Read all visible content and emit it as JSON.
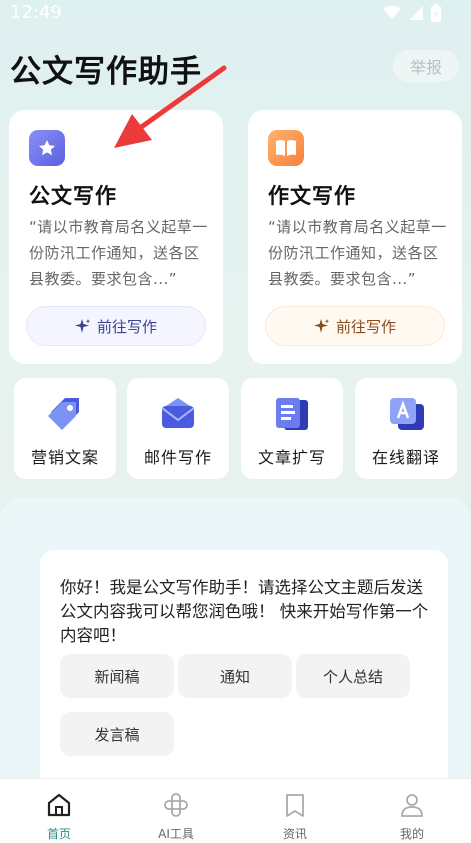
{
  "status_bar": {
    "time": "12:49"
  },
  "header": {
    "title": "公文写作助手",
    "report_label": "举报"
  },
  "cards": [
    {
      "title": "公文写作",
      "desc": "“请以市教育局名义起草一份防汛工作通知，送各区县教委。要求包含...”",
      "button": "前往写作",
      "icon": "star-icon"
    },
    {
      "title": "作文写作",
      "desc": "“请以市教育局名义起草一份防汛工作通知，送各区县教委。要求包含...”",
      "button": "前往写作",
      "icon": "book-icon"
    }
  ],
  "tools": [
    {
      "label": "营销文案",
      "icon": "tag-icon"
    },
    {
      "label": "邮件写作",
      "icon": "mail-icon"
    },
    {
      "label": "文章扩写",
      "icon": "document-icon"
    },
    {
      "label": "在线翻译",
      "icon": "translate-icon"
    }
  ],
  "chat": {
    "message": "你好！我是公文写作助手！请选择公文主题后发送公文内容我可以帮您润色哦！ 快来开始写作第一个内容吧！",
    "chips": [
      "新闻稿",
      "通知",
      "个人总结",
      "发言稿"
    ]
  },
  "nav": [
    {
      "label": "首页",
      "icon": "home-icon",
      "active": true
    },
    {
      "label": "AI工具",
      "icon": "ai-tools-icon",
      "active": false
    },
    {
      "label": "资讯",
      "icon": "news-icon",
      "active": false
    },
    {
      "label": "我的",
      "icon": "profile-icon",
      "active": false
    }
  ],
  "colors": {
    "accent": "#2e8c87",
    "background": "#e3f2ef",
    "card_left_accent": "#5a60e0",
    "card_right_accent": "#f77f3e",
    "arrow": "#ec3a3a"
  }
}
